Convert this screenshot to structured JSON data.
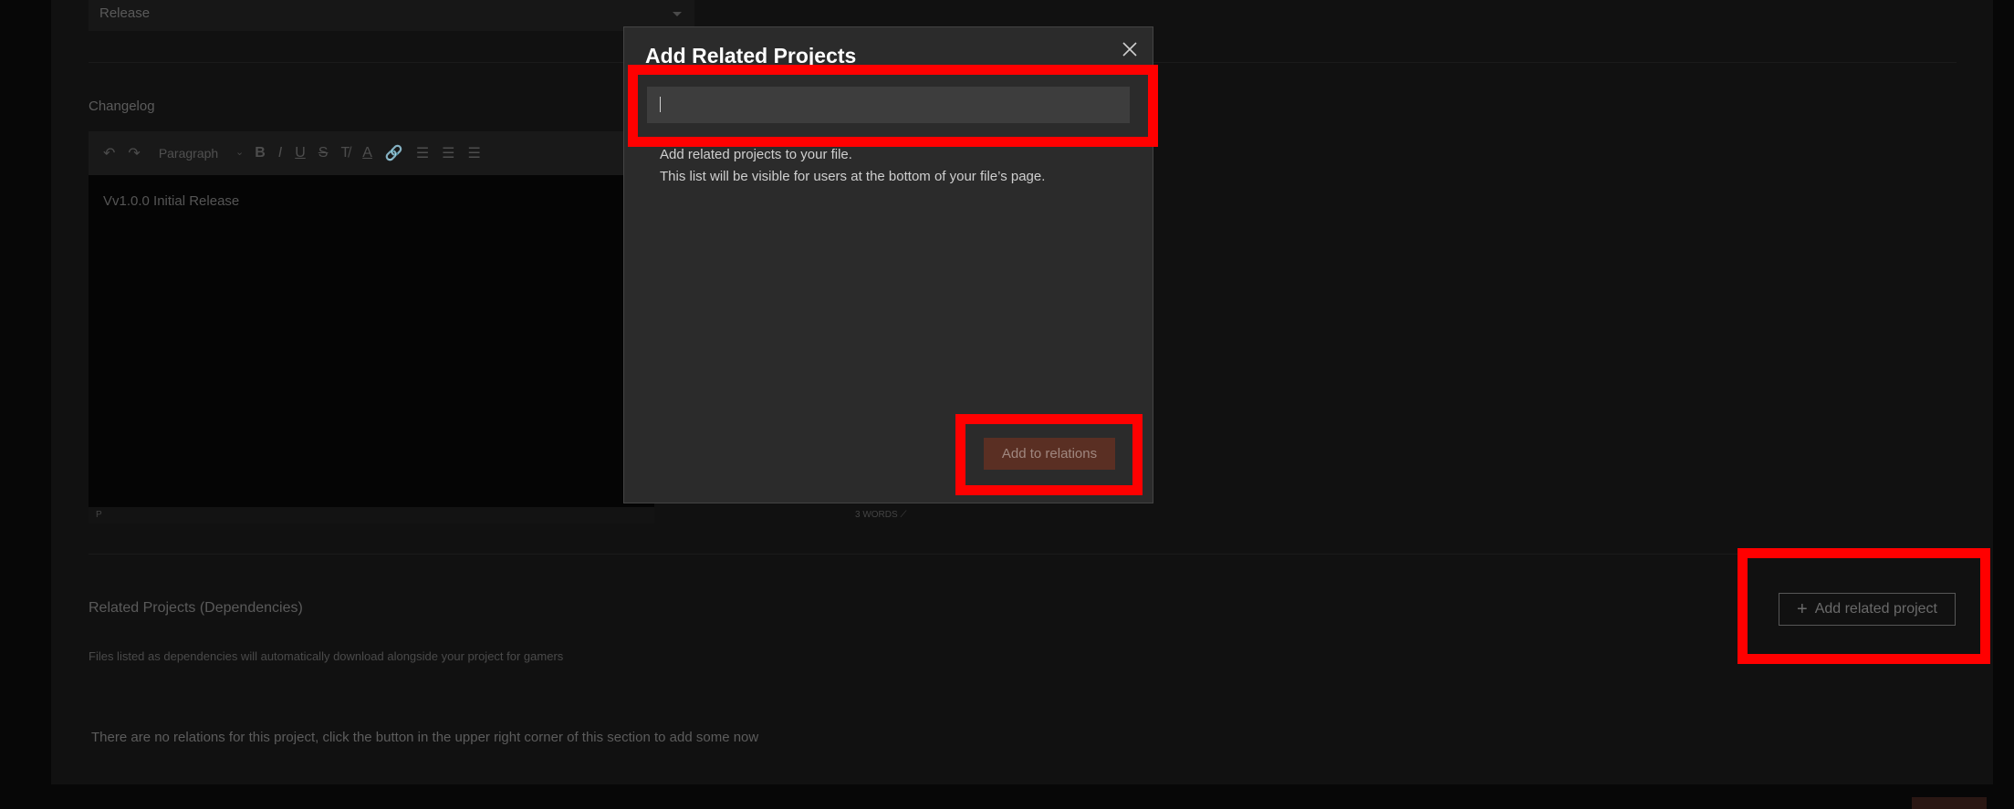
{
  "background_form": {
    "release_select_value": "Release",
    "changelog_label": "Changelog",
    "editor": {
      "block_format": "Paragraph",
      "content": "Vv1.0.0 Initial Release",
      "status_path": "P",
      "word_count": "3 WORDS"
    },
    "related": {
      "title": "Related Projects (Dependencies)",
      "subtitle": "Files listed as dependencies will automatically download alongside your project for gamers",
      "add_button_label": "Add related project",
      "empty_message": "There are no relations for this project, click the button in the upper right corner of this section to add some now"
    }
  },
  "modal": {
    "title": "Add Related Projects",
    "search_value": "",
    "help_line1": "Add related projects to your file.",
    "help_line2": "This list will be visible for users at the bottom of your file’s page.",
    "submit_label": "Add to relations"
  },
  "colors": {
    "highlight": "#ff0000",
    "submit_bg": "#5a2f23",
    "modal_bg": "#2b2b2b"
  }
}
